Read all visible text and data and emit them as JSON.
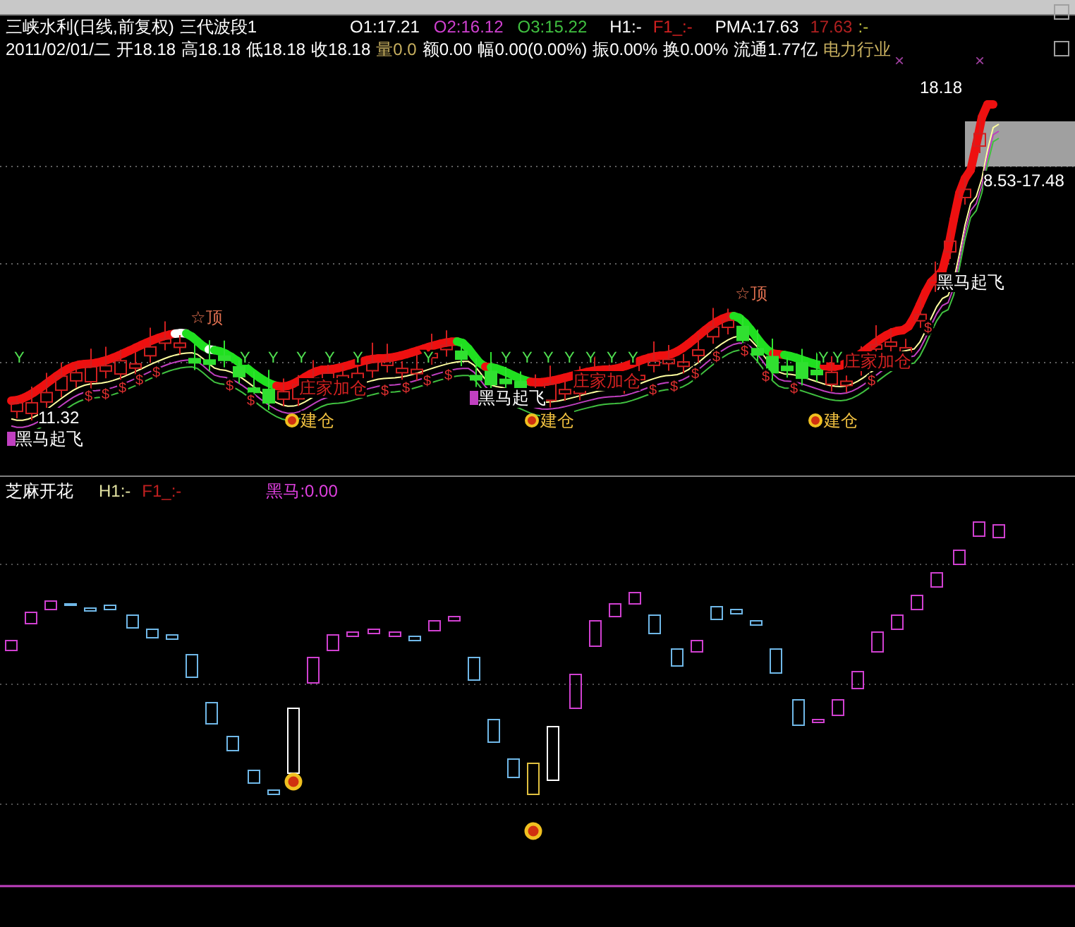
{
  "header": {
    "stock_name": "三峡水利(日线,前复权)",
    "indicator": "三代波段1",
    "values": [
      {
        "text": "O1:17.21",
        "color": "#ffffff"
      },
      {
        "text": "O2:16.12",
        "color": "#d040d0"
      },
      {
        "text": "O3:15.22",
        "color": "#40c040"
      },
      {
        "text": "H1:-",
        "color": "#ffffff"
      },
      {
        "text": "F1_:-",
        "color": "#d02020"
      },
      {
        "text": "PMA:17.63",
        "color": "#ffffff"
      },
      {
        "text": "17.63",
        "color": "#b02020"
      },
      {
        "text": ":-",
        "color": "#c0c040"
      }
    ],
    "quote": [
      {
        "text": "2011/02/01/二",
        "color": "#ffffff"
      },
      {
        "text": "开18.18",
        "color": "#ffffff"
      },
      {
        "text": "高18.18",
        "color": "#ffffff"
      },
      {
        "text": "低18.18",
        "color": "#ffffff"
      },
      {
        "text": "收18.18",
        "color": "#ffffff"
      },
      {
        "text": "量0.0",
        "color": "#c8b060"
      },
      {
        "text": "额0.00",
        "color": "#ffffff"
      },
      {
        "text": "幅0.00(0.00%)",
        "color": "#ffffff"
      },
      {
        "text": "振0.00%",
        "color": "#ffffff"
      },
      {
        "text": "换0.00%",
        "color": "#ffffff"
      },
      {
        "text": "流通1.77亿",
        "color": "#ffffff"
      },
      {
        "text": "电力行业",
        "color": "#c8b060"
      }
    ]
  },
  "price_chart": {
    "annotations": [
      {
        "kind": "text",
        "text": "×",
        "color": "#a040a0"
      },
      {
        "kind": "text",
        "text": "×",
        "color": "#a040a0"
      },
      {
        "kind": "text",
        "text": "18.18",
        "color": "#ffffff"
      },
      {
        "kind": "text",
        "text": "8.53-17.48",
        "color": "#ffffff"
      },
      {
        "kind": "text",
        "text": "黑马起飞",
        "color": "#ffffff"
      },
      {
        "kind": "text",
        "text": "☆顶",
        "color": "#e07050"
      },
      {
        "kind": "text",
        "text": "☆顶",
        "color": "#e07050"
      },
      {
        "kind": "text",
        "text": "庄家加仓",
        "color": "#d02020"
      },
      {
        "kind": "text",
        "text": "庄家加仓",
        "color": "#d02020"
      },
      {
        "kind": "text",
        "text": "庄家加仓",
        "color": "#d02020"
      },
      {
        "kind": "flag",
        "text": "黑马起飞",
        "color": "#ffffff"
      },
      {
        "kind": "text",
        "text": "11.32",
        "color": "#ffffff"
      },
      {
        "kind": "dot",
        "text": "建仓",
        "color": "#f0c040"
      },
      {
        "kind": "dot",
        "text": "建仓",
        "color": "#f0c040"
      },
      {
        "kind": "dot",
        "text": "建仓",
        "color": "#f0c040"
      },
      {
        "kind": "flag",
        "text": "黑马起飞",
        "color": "#ffffff"
      }
    ],
    "y_marks": [
      "Y",
      "Y",
      "Y",
      "Y",
      "Y",
      "Y",
      "Y",
      "Y",
      "Y",
      "Y",
      "Y",
      "Y",
      "Y",
      "Y",
      "Y",
      "Y"
    ],
    "dollar_marks": [
      "$",
      "$",
      "$",
      "$",
      "$",
      "$",
      "$",
      "$",
      "$",
      "$",
      "$",
      "$",
      "$",
      "$",
      "$",
      "$",
      "$",
      "$",
      "$",
      "$"
    ]
  },
  "sub_chart": {
    "title": "芝麻开花",
    "values": [
      {
        "text": "H1:-",
        "color": "#e0e0a0"
      },
      {
        "text": "F1_:-",
        "color": "#c02020"
      },
      {
        "text": "黑马:0.00",
        "color": "#e040e0"
      }
    ]
  }
}
